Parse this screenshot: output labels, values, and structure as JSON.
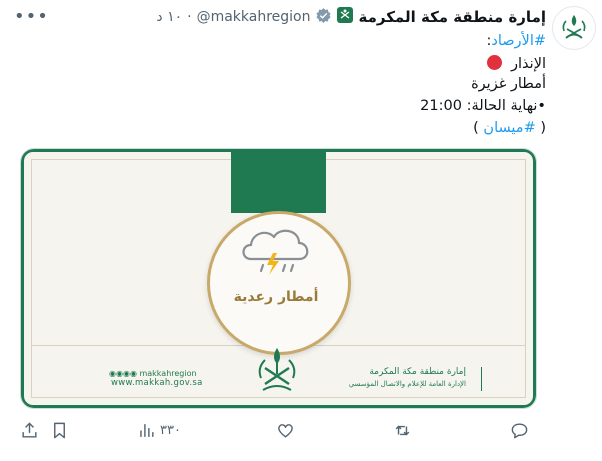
{
  "header": {
    "display_name": "إمارة منطقة مكة المكرمة",
    "handle": "@makkahregion",
    "separator": "·",
    "time": "١٠ د",
    "more_icon": "more-icon"
  },
  "tweet": {
    "line1_hashtag": "#الأرصاد",
    "line1_suffix": ":",
    "line2_text": "الإنذار",
    "line2_icon": "red-circle-icon",
    "line3_text": "أمطار غزيرة",
    "line4_text": "•نهاية الحالة: 21:00",
    "line5_open": "(",
    "line5_hashtag": "#ميسان",
    "line5_close": ")"
  },
  "card": {
    "caption": "أمطار رعدية",
    "footer_handle": "makkahregion",
    "footer_website": "www.makkah.gov.sa",
    "footer_org": "إمارة منطقة مكة المكرمة",
    "footer_dept": "الإدارة العامة للإعلام والاتصال المؤسسي",
    "brand_green": "#1f7a52",
    "gold": "#c9a96a"
  },
  "actions": {
    "views": "٣٣٠"
  },
  "colors": {
    "link": "#1d9bf0",
    "muted": "#536471",
    "alert": "#e0313c"
  }
}
